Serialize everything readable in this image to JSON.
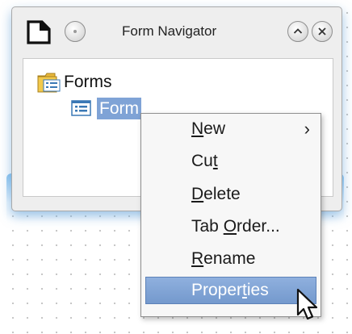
{
  "window": {
    "title": "Form Navigator"
  },
  "tree": {
    "root": "Forms",
    "child": "Form"
  },
  "context_menu": {
    "items": [
      {
        "pre": "",
        "mn": "N",
        "post": "ew",
        "submenu": true
      },
      {
        "pre": "Cu",
        "mn": "t",
        "post": ""
      },
      {
        "pre": "",
        "mn": "D",
        "post": "elete"
      },
      {
        "pre": "Tab ",
        "mn": "O",
        "post": "rder..."
      },
      {
        "pre": "",
        "mn": "R",
        "post": "ename"
      },
      {
        "pre": "Proper",
        "mn": "t",
        "post": "ies",
        "active": true
      }
    ],
    "submenu_glyph": "›"
  },
  "colors": {
    "selection": "#7fa3d6",
    "menu_highlight": "#7499cd",
    "window_glow": "#78b9eb"
  }
}
